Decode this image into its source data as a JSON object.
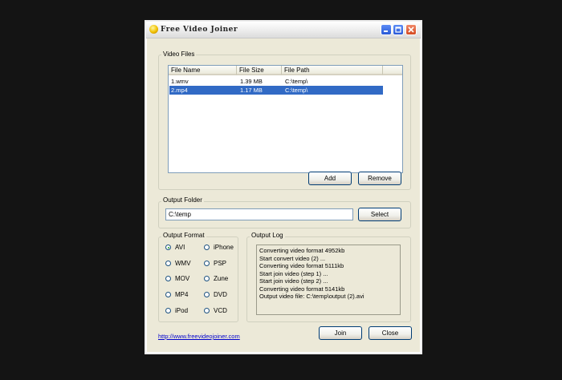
{
  "window": {
    "title": "Free Video Joiner"
  },
  "video_files": {
    "legend": "Video Files",
    "columns": [
      "File Name",
      "File Size",
      "File Path"
    ],
    "rows": [
      {
        "name": "1.wmv",
        "size": "1.39 MB",
        "path": "C:\\temp\\"
      },
      {
        "name": "2.mp4",
        "size": "1.17 MB",
        "path": "C:\\temp\\",
        "selected": true
      }
    ],
    "add_label": "Add",
    "remove_label": "Remove"
  },
  "output_folder": {
    "legend": "Output Folder",
    "value": "C:\\temp",
    "select_label": "Select"
  },
  "output_format": {
    "legend": "Output Format",
    "options": [
      "AVI",
      "WMV",
      "MOV",
      "MP4",
      "iPod",
      "iPhone",
      "PSP",
      "Zune",
      "DVD",
      "VCD"
    ],
    "selected": "AVI"
  },
  "output_log": {
    "legend": "Output Log",
    "lines": [
      "Converting video format 4952kb",
      "Start convert video (2) ...",
      "Converting video format 5111kb",
      "Start join video (step 1) ...",
      "Start join video (step 2) ...",
      "Converting video format 5141kb",
      "Output video file: C:\\temp\\output (2).avi"
    ]
  },
  "footer": {
    "website": "http://www.freevideojoiner.com",
    "join_label": "Join",
    "close_label": "Close"
  },
  "colors": {
    "selection": "#316ac5",
    "window_bg": "#ece9d8",
    "link": "#0000cc"
  }
}
